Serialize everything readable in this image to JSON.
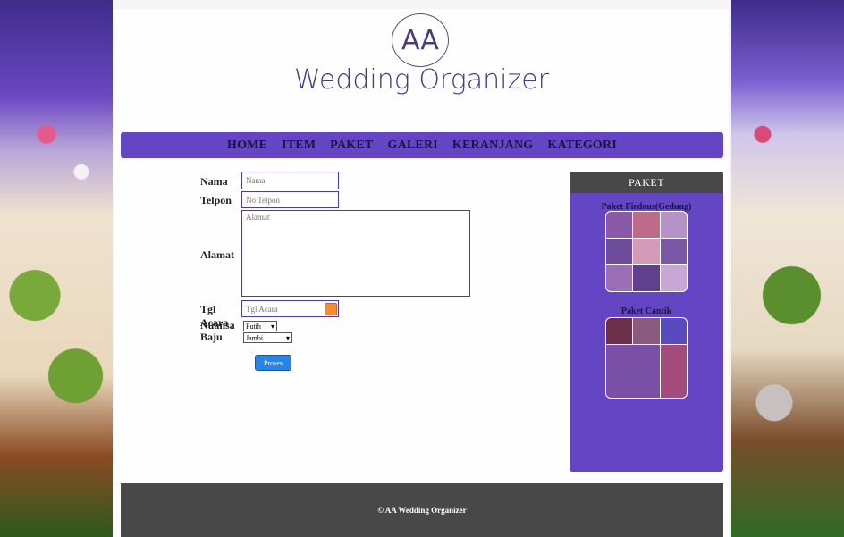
{
  "logo": {
    "initials": "AA",
    "title": "Wedding Organizer"
  },
  "nav": {
    "items": [
      "HOME",
      "ITEM",
      "PAKET",
      "GALERI",
      "KERANJANG",
      "KATEGORI"
    ]
  },
  "form": {
    "nama": {
      "label": "Nama",
      "placeholder": "Nama"
    },
    "telpon": {
      "label": "Telpon",
      "placeholder": "No Telpon"
    },
    "alamat": {
      "label": "Alamat",
      "placeholder": "Alamat"
    },
    "tgl_acara": {
      "label": "Tgl Acara",
      "placeholder": "Tgl Acara"
    },
    "nuansa": {
      "label": "Nuansa",
      "value": "Putih"
    },
    "baju": {
      "label": "Baju",
      "value": "Jambi"
    },
    "submit_label": "Proses"
  },
  "sidebar": {
    "title": "PAKET",
    "packages": [
      {
        "name": "Paket Firdaus(Gedung)"
      },
      {
        "name": "Paket Cantik"
      }
    ]
  },
  "footer": {
    "text": "© AA Wedding Organizer"
  }
}
